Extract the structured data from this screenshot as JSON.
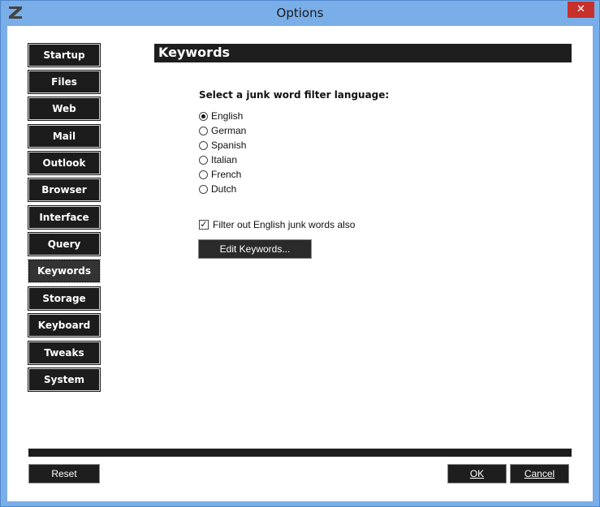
{
  "window": {
    "title": "Options",
    "close_glyph": "✕",
    "app_icon": "z-logo-icon"
  },
  "nav": {
    "items": [
      {
        "label": "Startup"
      },
      {
        "label": "Files"
      },
      {
        "label": "Web"
      },
      {
        "label": "Mail"
      },
      {
        "label": "Outlook"
      },
      {
        "label": "Browser"
      },
      {
        "label": "Interface"
      },
      {
        "label": "Query"
      },
      {
        "label": "Keywords",
        "active": true
      },
      {
        "label": "Storage"
      },
      {
        "label": "Keyboard"
      },
      {
        "label": "Tweaks"
      },
      {
        "label": "System"
      }
    ]
  },
  "section": {
    "title": "Keywords",
    "language_prompt": "Select a junk word filter language:",
    "languages": [
      {
        "label": "English",
        "selected": true
      },
      {
        "label": "German",
        "selected": false
      },
      {
        "label": "Spanish",
        "selected": false
      },
      {
        "label": "Italian",
        "selected": false
      },
      {
        "label": "French",
        "selected": false
      },
      {
        "label": "Dutch",
        "selected": false
      }
    ],
    "filter_english_label": "Filter out English junk words also",
    "filter_english_checked": true,
    "edit_keywords_label": "Edit Keywords..."
  },
  "footer": {
    "reset_label": "Reset",
    "ok_label": "OK",
    "cancel_label": "Cancel"
  },
  "colors": {
    "title_bar": "#7aaee8",
    "button_bg": "#1c1c1c",
    "close_button": "#c7312b"
  }
}
